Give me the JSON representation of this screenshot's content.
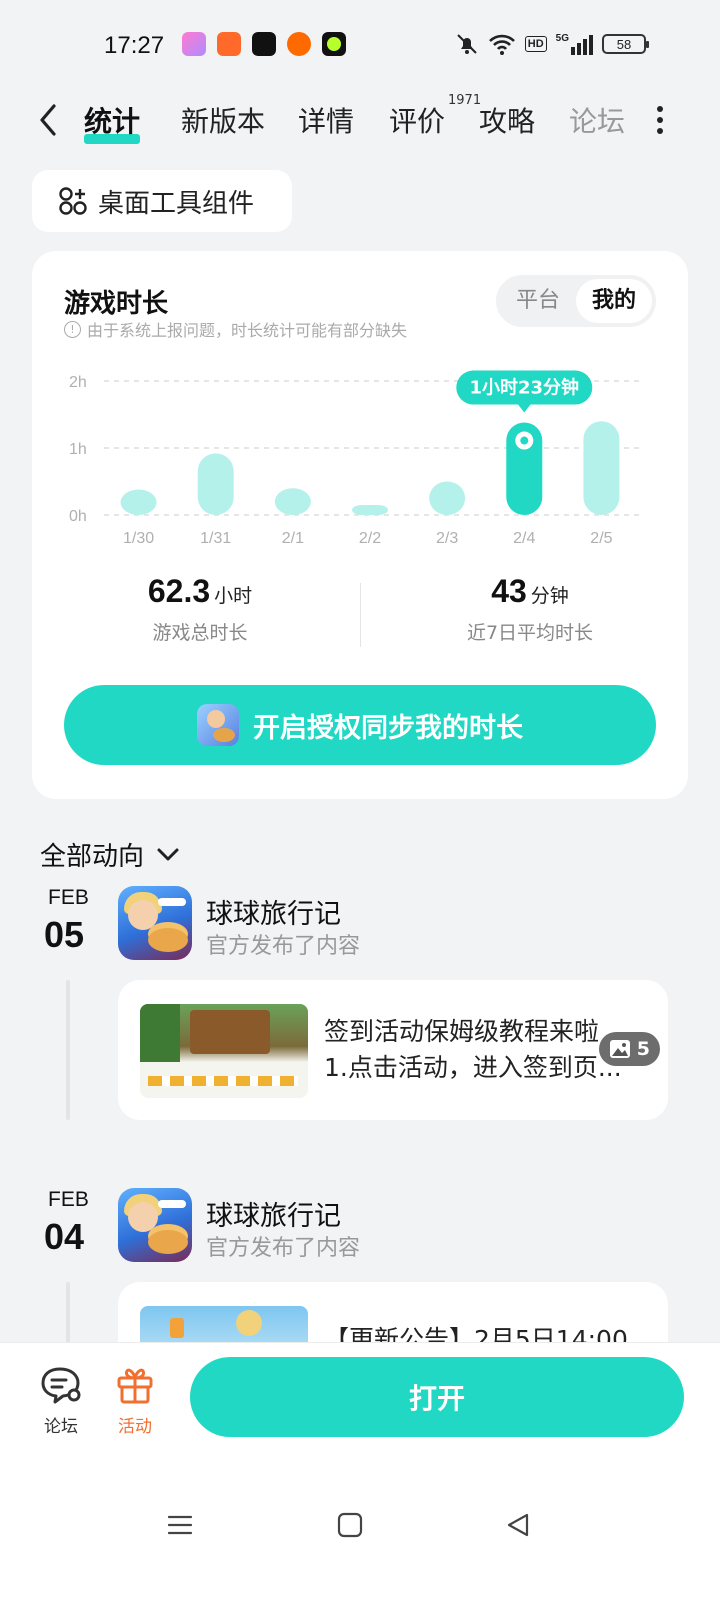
{
  "status_bar": {
    "time": "17:27",
    "notification_icons": [
      "camera-app-icon",
      "link-app-icon",
      "capcut-icon",
      "pumpkin-game-icon",
      "green-dot-app-icon"
    ],
    "hd_label": "HD",
    "network": "5G",
    "battery": "58"
  },
  "tabs": [
    {
      "label": "统计",
      "active": true
    },
    {
      "label": "新版本"
    },
    {
      "label": "详情"
    },
    {
      "label": "评价",
      "badge": "1971"
    },
    {
      "label": "攻略"
    },
    {
      "label": "论坛"
    }
  ],
  "widget_chip": {
    "label": "桌面工具组件"
  },
  "stats_card": {
    "title": "游戏时长",
    "note": "由于系统上报问题，时长统计可能有部分缺失",
    "segment": {
      "options": [
        "平台",
        "我的"
      ],
      "selected": "我的"
    }
  },
  "chart_data": {
    "type": "bar",
    "categories": [
      "1/30",
      "1/31",
      "2/1",
      "2/2",
      "2/3",
      "2/4",
      "2/5"
    ],
    "values": [
      0.38,
      0.92,
      0.4,
      0.15,
      0.5,
      1.38,
      1.4
    ],
    "y_ticks": [
      "0h",
      "1h",
      "2h"
    ],
    "ylim": [
      0,
      2
    ],
    "grid": true,
    "highlight_index": 5,
    "highlight_label": "1小时23分钟",
    "colors": {
      "bar": "#b4f1ea",
      "highlight": "#20d8c4",
      "grid": "#dddddd"
    }
  },
  "summary": {
    "total": {
      "value": "62.3",
      "unit": "小时",
      "label": "游戏总时长"
    },
    "average": {
      "value": "43",
      "unit": "分钟",
      "label": "近7日平均时长"
    }
  },
  "sync_button": {
    "label": "开启授权同步我的时长"
  },
  "feed": {
    "filter_label": "全部动向",
    "items": [
      {
        "month": "FEB",
        "day": "05",
        "app_name": "球球旅行记",
        "action": "官方发布了内容",
        "image_count": "5",
        "line1": "签到活动保姆级教程来啦",
        "line2": "1.点击活动，进入签到页..."
      },
      {
        "month": "FEB",
        "day": "04",
        "app_name": "球球旅行记",
        "action": "官方发布了内容",
        "line1": "【更新公告】2月5日14:00"
      }
    ]
  },
  "bottom_bar": {
    "forum_label": "论坛",
    "activity_label": "活动",
    "open_label": "打开",
    "colors": {
      "accent": "#20d8c4",
      "activity": "#f07030"
    }
  }
}
